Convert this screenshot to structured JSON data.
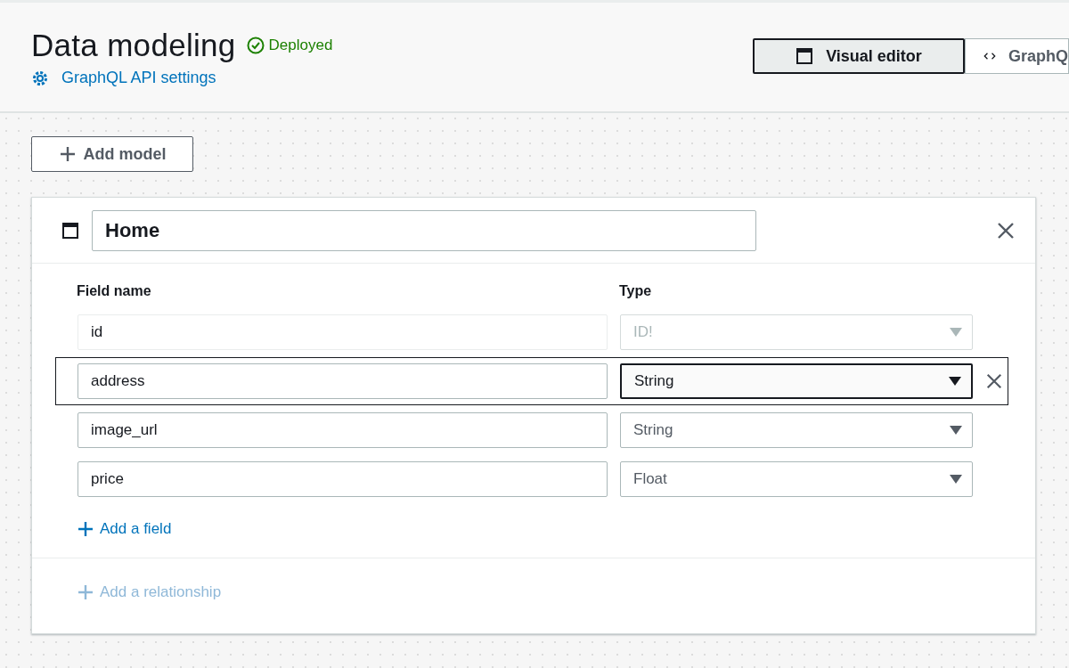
{
  "header": {
    "title": "Data modeling",
    "status": "Deployed",
    "settings_link": "GraphQL API settings"
  },
  "view_tabs": [
    {
      "label": "Visual editor",
      "kind": "visual",
      "selected": true
    },
    {
      "label": "GraphQ",
      "kind": "code",
      "selected": false
    }
  ],
  "add_model": "Add model",
  "model": {
    "name": "Home",
    "columns": [
      "Field name",
      "Type"
    ],
    "fields": [
      {
        "name": "id",
        "type": "ID!",
        "disabled": true,
        "selected": false
      },
      {
        "name": "address",
        "type": "String",
        "disabled": false,
        "selected": true
      },
      {
        "name": "image_url",
        "type": "String",
        "disabled": false,
        "selected": false
      },
      {
        "name": "price",
        "type": "Float",
        "disabled": false,
        "selected": false
      }
    ],
    "add_field": {
      "label": "Add a field",
      "disabled": false
    },
    "add_relationship": {
      "label": "Add a relationship",
      "disabled": true
    }
  }
}
